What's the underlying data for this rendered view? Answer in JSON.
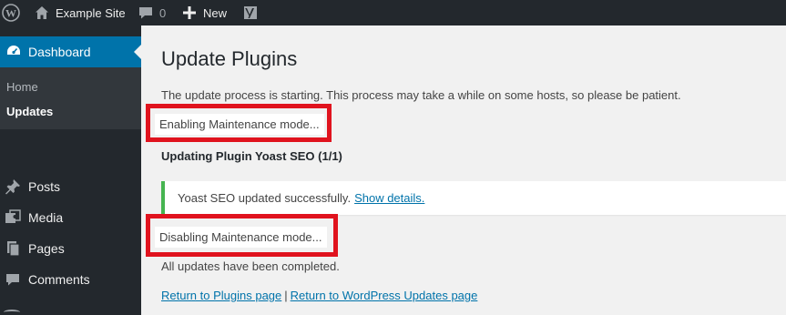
{
  "adminbar": {
    "site_name": "Example Site",
    "comments_count": "0",
    "new_label": "New"
  },
  "sidebar": {
    "dashboard_label": "Dashboard",
    "submenu": [
      {
        "label": "Home"
      },
      {
        "label": "Updates"
      }
    ],
    "items": [
      {
        "label": "Posts"
      },
      {
        "label": "Media"
      },
      {
        "label": "Pages"
      },
      {
        "label": "Comments"
      }
    ]
  },
  "main": {
    "title": "Update Plugins",
    "intro": "The update process is starting. This process may take a while on some hosts, so please be patient.",
    "enabling": "Enabling Maintenance mode...",
    "updating": "Updating Plugin Yoast SEO (1/1)",
    "notice_text": "Yoast SEO updated successfully.",
    "notice_link": "Show details.",
    "disabling": "Disabling Maintenance mode...",
    "completed": "All updates have been completed.",
    "link_plugins": "Return to Plugins page",
    "link_separator": "|",
    "link_updates": "Return to WordPress Updates page"
  },
  "colors": {
    "adminbar_bg": "#23282d",
    "accent": "#0073aa",
    "highlight_box": "#e0131e",
    "success": "#46b450"
  }
}
